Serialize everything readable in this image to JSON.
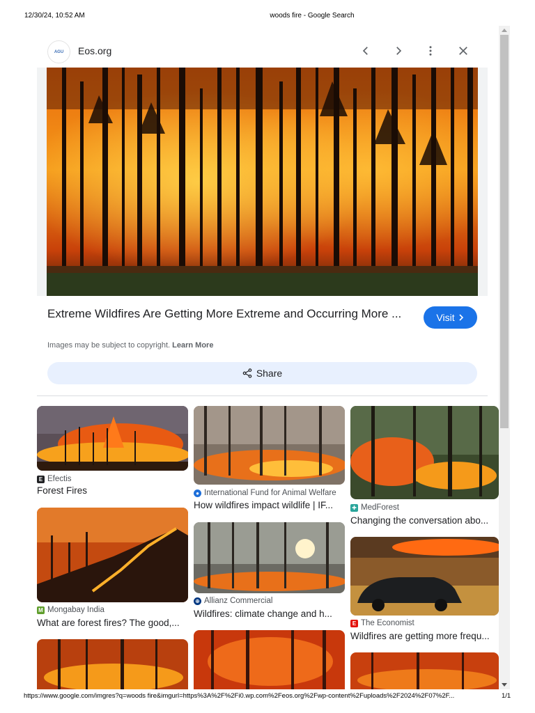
{
  "print_header": {
    "datetime": "12/30/24, 10:52 AM",
    "page_title": "woods fire - Google Search"
  },
  "print_footer": {
    "url": "https://www.google.com/imgres?q=woods fire&imgurl=https%3A%2F%2Fi0.wp.com%2Feos.org%2Fwp-content%2Fuploads%2F2024%2F07%2F...",
    "page_number": "1/1"
  },
  "viewer": {
    "favicon_text": "AGU",
    "site_name": "Eos.org",
    "headline": "Extreme Wildfires Are Getting More Extreme and Occurring More ...",
    "visit_label": "Visit",
    "copyright_text": "Images may be subject to copyright.",
    "learn_more_label": "Learn More",
    "share_label": "Share",
    "icons": {
      "prev": "chevron-left-icon",
      "next": "chevron-right-icon",
      "more": "more-vert-icon",
      "close": "close-icon",
      "share": "share-icon",
      "visit": "chevron-right-icon"
    }
  },
  "results": [
    {
      "source": "Efectis",
      "source_icon": "E",
      "source_color": "#202124",
      "title": "Forest Fires"
    },
    {
      "source": "International Fund for Animal Welfare",
      "source_icon": "●",
      "source_color": "#1e6fd9",
      "title": "How wildfires impact wildlife | IF..."
    },
    {
      "source": "MedForest",
      "source_icon": "✚",
      "source_color": "#2aa59b",
      "title": "Changing the conversation abo..."
    },
    {
      "source": "Mongabay India",
      "source_icon": "M",
      "source_color": "#5f9e2c",
      "title": "What are forest fires? The good,..."
    },
    {
      "source": "Allianz Commercial",
      "source_icon": "⊕",
      "source_color": "#003781",
      "title": "Wildfires: climate change and h..."
    },
    {
      "source": "The Economist",
      "source_icon": "E",
      "source_color": "#e3120b",
      "title": "Wildfires are getting more frequ..."
    }
  ],
  "colors": {
    "accent": "#1a73e8",
    "share_bg": "#e8f0fe"
  }
}
